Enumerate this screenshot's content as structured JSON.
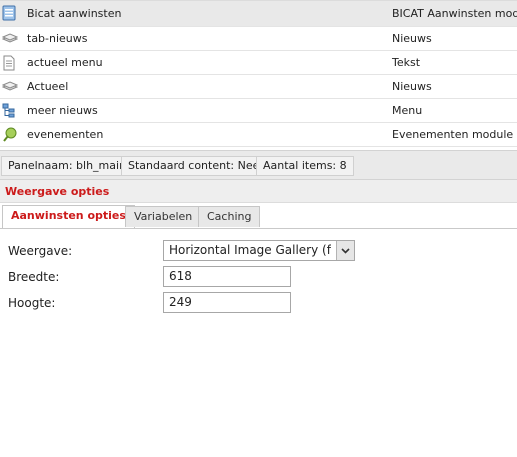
{
  "items": [
    {
      "name": "Bicat aanwinsten",
      "type": "BICAT Aanwinsten modul",
      "icon": "module-icon",
      "selected": true
    },
    {
      "name": "tab-nieuws",
      "type": "Nieuws",
      "icon": "news-stack-icon"
    },
    {
      "name": "actueel menu",
      "type": "Tekst",
      "icon": "text-document-icon"
    },
    {
      "name": "Actueel",
      "type": "Nieuws",
      "icon": "news-stack-icon"
    },
    {
      "name": "meer nieuws",
      "type": "Menu",
      "icon": "menu-tree-icon"
    },
    {
      "name": "evenementen",
      "type": "Evenementen module",
      "icon": "event-icon"
    }
  ],
  "status": {
    "panel_name": "Panelnaam: blh_main",
    "default_content": "Standaard content: Nee",
    "item_count": "Aantal items: 8"
  },
  "section": {
    "title": "Weergave opties"
  },
  "tabs": [
    {
      "label": "Aanwinsten opties",
      "active": true
    },
    {
      "label": "Variabelen"
    },
    {
      "label": "Caching"
    }
  ],
  "form": {
    "weergave_label": "Weergave:",
    "weergave_value": "Horizontal Image Gallery (flash",
    "breedte_label": "Breedte:",
    "breedte_value": "618",
    "hoogte_label": "Hoogte:",
    "hoogte_value": "249"
  },
  "colors": {
    "accent": "#cc1a1a"
  }
}
